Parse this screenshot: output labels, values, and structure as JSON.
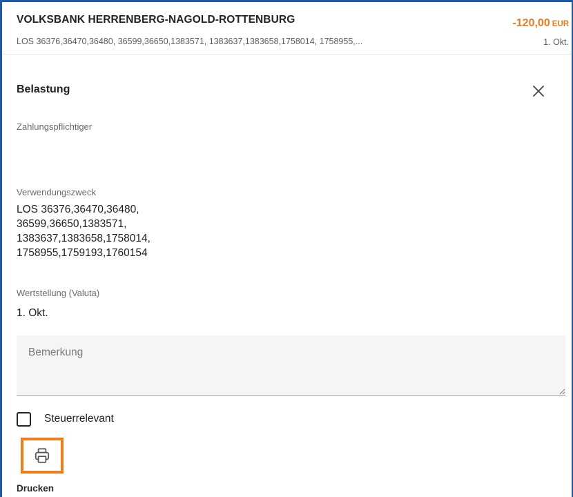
{
  "transaction": {
    "payee": "VOLKSBANK HERRENBERG-NAGOLD-ROTTENBURG",
    "purpose_short": "LOS 36376,36470,36480, 36599,36650,1383571, 1383637,1383658,1758014, 1758955,...",
    "amount": "-120,00",
    "currency": "EUR",
    "date": "1. Okt."
  },
  "detail": {
    "title": "Belastung",
    "payer_label": "Zahlungspflichtiger",
    "payer_value": "",
    "purpose_label": "Verwendungszweck",
    "purpose_lines": [
      "LOS 36376,36470,36480,",
      "36599,36650,1383571,",
      "1383637,1383658,1758014,",
      "1758955,1759193,1760154"
    ],
    "valuta_label": "Wertstellung (Valuta)",
    "valuta_value": "1. Okt.",
    "note_placeholder": "Bemerkung",
    "note_value": "",
    "tax_label": "Steuerrelevant",
    "tax_checked": false,
    "print_label": "Drucken"
  },
  "icons": {
    "close": "close-icon",
    "print": "printer-icon"
  },
  "colors": {
    "amount": "#ec7a1c",
    "print_highlight": "#ee7d1a",
    "frame_border": "#1f5aa6",
    "note_background": "#f5f5f5"
  }
}
